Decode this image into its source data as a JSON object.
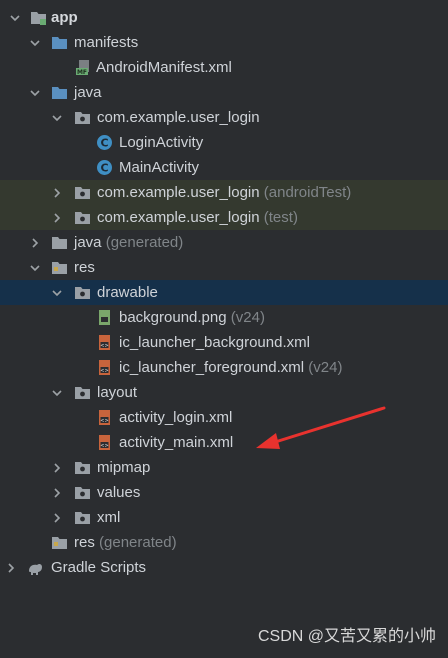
{
  "tree": {
    "app": "app",
    "manifests": "manifests",
    "manifest_file": "AndroidManifest.xml",
    "java": "java",
    "pkg_main": "com.example.user_login",
    "class_login": "LoginActivity",
    "class_main": "MainActivity",
    "pkg_android_test": "com.example.user_login",
    "pkg_android_test_suffix": "(androidTest)",
    "pkg_test": "com.example.user_login",
    "pkg_test_suffix": "(test)",
    "java_generated": "java",
    "java_generated_suffix": "(generated)",
    "res": "res",
    "drawable": "drawable",
    "file_background": "background.png",
    "file_background_suffix": "(v24)",
    "file_ic_bg": "ic_launcher_background.xml",
    "file_ic_fg": "ic_launcher_foreground.xml",
    "file_ic_fg_suffix": "(v24)",
    "layout": "layout",
    "file_activity_login": "activity_login.xml",
    "file_activity_main": "activity_main.xml",
    "mipmap": "mipmap",
    "values": "values",
    "xml": "xml",
    "res_generated": "res",
    "res_generated_suffix": "(generated)",
    "gradle": "Gradle Scripts"
  },
  "watermark": "CSDN @又苦又累的小帅",
  "colors": {
    "background": "#2b2d30",
    "selected_row": "#15304a",
    "test_rows": "#34392f",
    "folder_blue": "#5a8fbf",
    "folder_gray": "#9aa0a6",
    "class_icon": "#3f8fc4",
    "xml_icon": "#c8643c",
    "annotation_arrow": "#e8322e"
  }
}
